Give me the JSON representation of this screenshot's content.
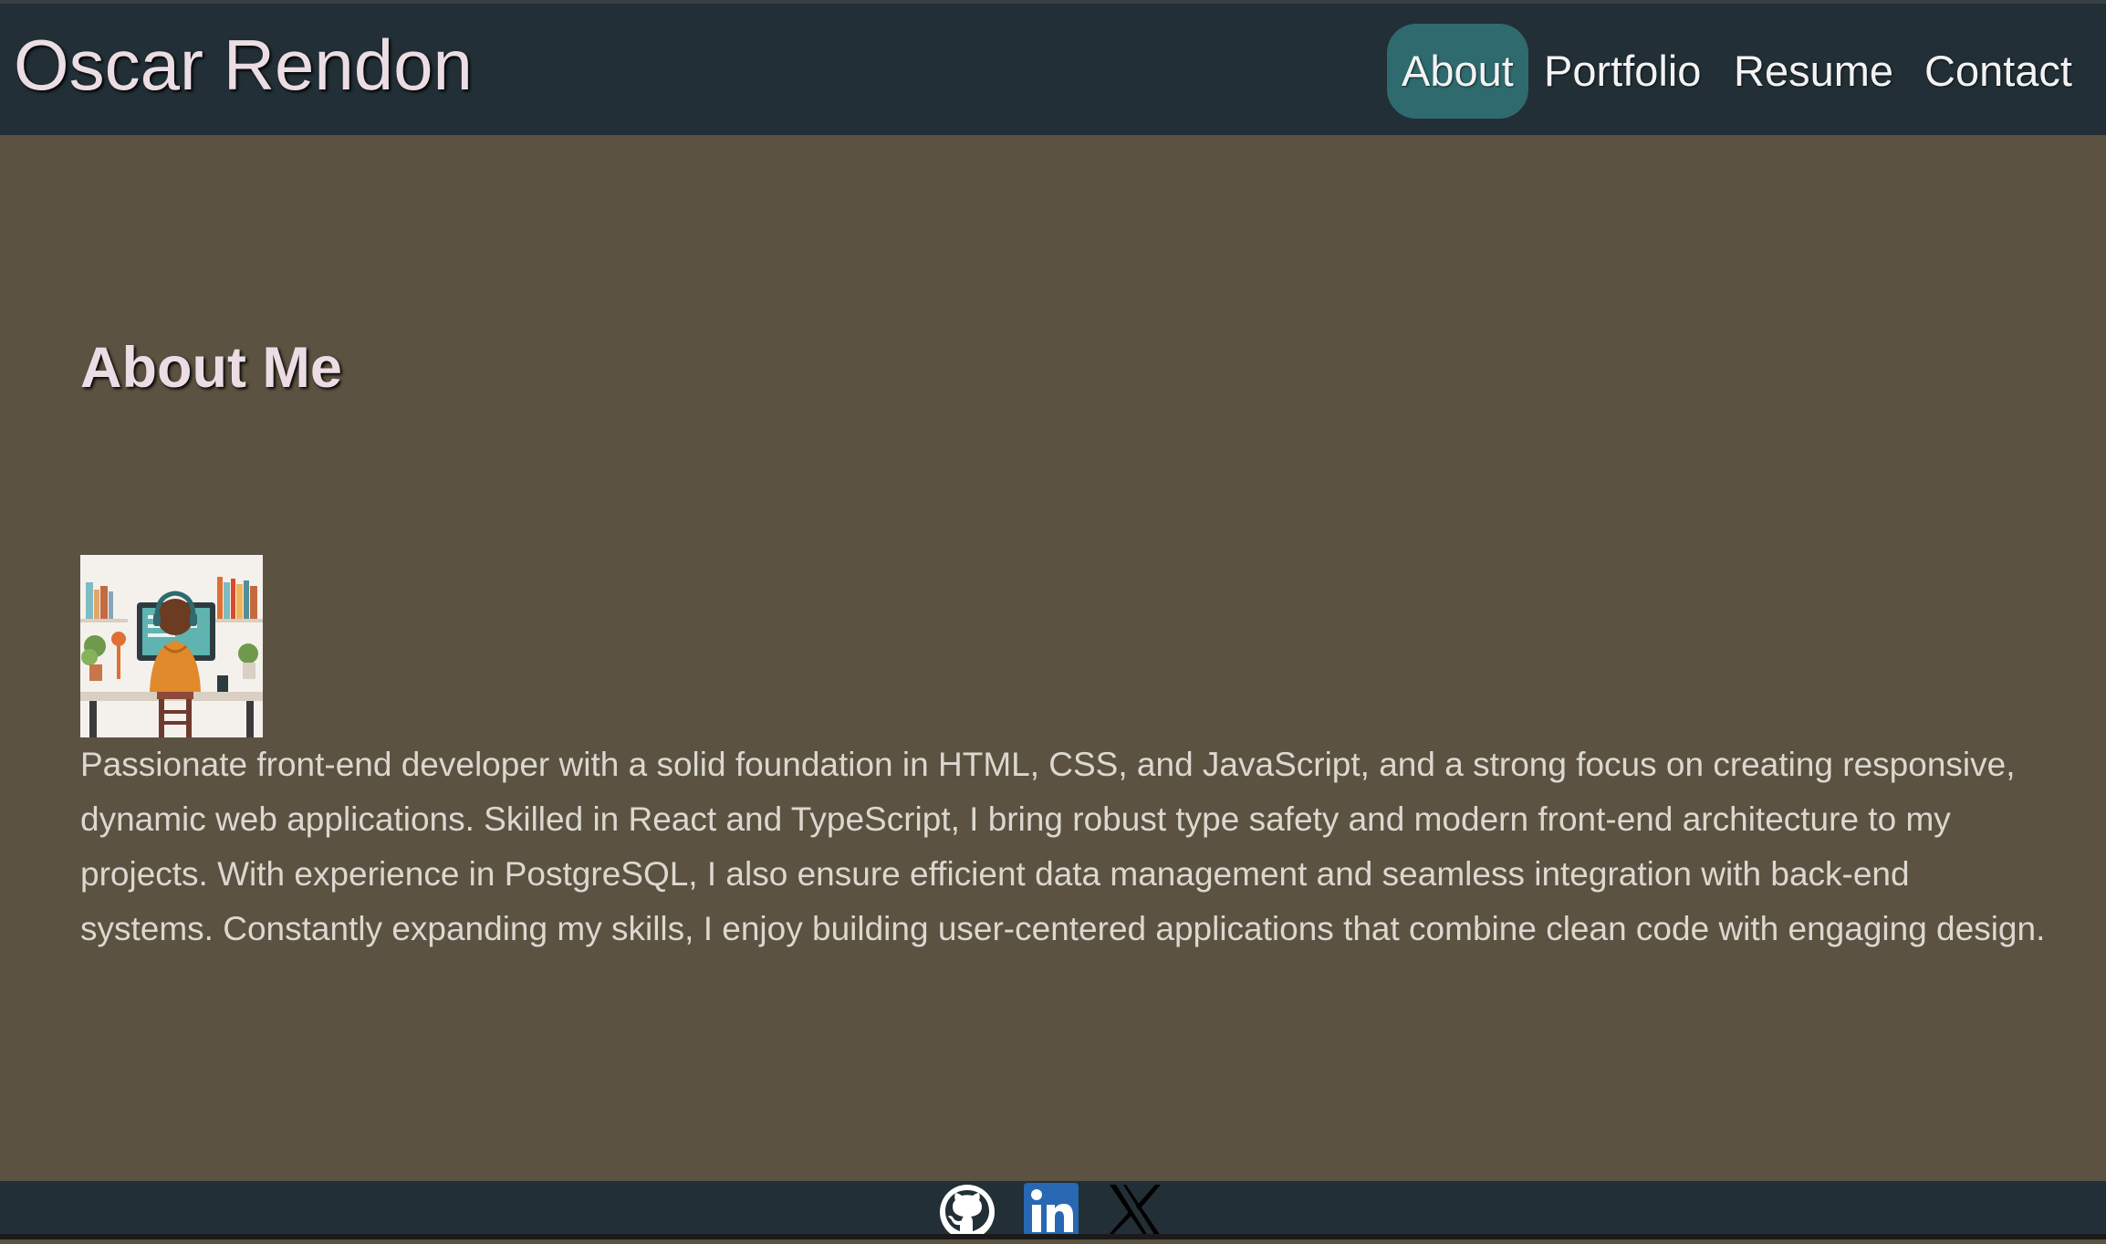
{
  "header": {
    "brand": "Oscar Rendon",
    "nav": [
      {
        "label": "About",
        "active": true
      },
      {
        "label": "Portfolio",
        "active": false
      },
      {
        "label": "Resume",
        "active": false
      },
      {
        "label": "Contact",
        "active": false
      }
    ]
  },
  "about": {
    "title": "About Me",
    "bio": "Passionate front-end developer with a solid foundation in HTML, CSS, and JavaScript, and a strong focus on creating responsive, dynamic web applications. Skilled in React and TypeScript, I bring robust type safety and modern front-end architecture to my projects. With experience in PostgreSQL, I also ensure efficient data management and seamless integration with back-end systems. Constantly expanding my skills, I enjoy building user-centered applications that combine clean code with engaging design."
  },
  "footer": {
    "social": [
      {
        "icon": "github-icon"
      },
      {
        "icon": "linkedin-icon"
      },
      {
        "icon": "x-icon"
      }
    ]
  },
  "colors": {
    "background": "#5b5241",
    "header": "#222f36",
    "nav_active": "#2f6a6e",
    "title_text": "#ecdde5",
    "body_text": "#dcd8d0",
    "linkedin": "#2867b2"
  }
}
